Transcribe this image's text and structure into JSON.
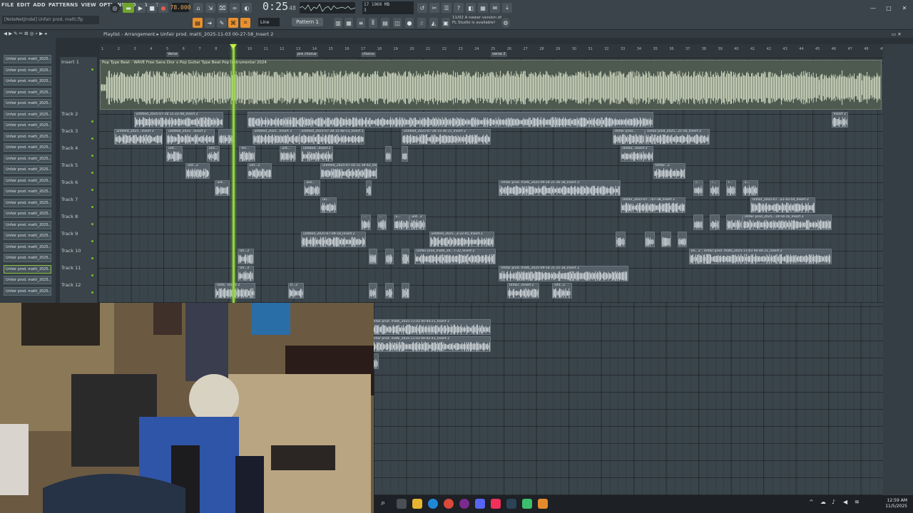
{
  "menu": [
    "FILE",
    "EDIT",
    "ADD",
    "PATTERNS",
    "VIEW",
    "OPTIONS",
    "TOOLS",
    "HELP"
  ],
  "transport": {
    "tempo": "78.000",
    "time": "0:25",
    "time_sub": "48",
    "play_icon": "play-icon",
    "stop_icon": "stop-icon",
    "record_icon": "record-icon"
  },
  "cpu": {
    "line1": "17    1960 MB",
    "line2": "3"
  },
  "hint_bar": "[NoteNetJindal] Unfair prod. matti.flp",
  "snap_mode": "Line",
  "pattern": "Pattern 1",
  "news": {
    "line1": "11/02  A newer version of",
    "line2": "FL Studio is available!"
  },
  "playlist": {
    "title": "Playlist - Arrangement",
    "breadcrumb": "Unfair prod. matti_2025-11-03 00-27-58_Insert 2"
  },
  "picker_items": [
    "Unfair prod. matti_2025...",
    "Unfair prod. matti_2025...",
    "Unfair prod. matti_2025...",
    "Unfair prod. matti_2025...",
    "Unfair prod. matti_2025...",
    "Unfair prod. matti_2025...",
    "Unfair prod. matti_2025...",
    "Unfair prod. matti_2025...",
    "Unfair prod. matti_2025...",
    "Unfair prod. matti_2025...",
    "Unfair prod. matti_2025...",
    "Unfair prod. matti_2025...",
    "Unfair prod. matti_2025...",
    "Unfair prod. matti_2025...",
    "Unfair prod. matti_2025...",
    "Unfair prod. matti_2025...",
    "Unfair prod. matti_2025...",
    "Unfair prod. matti_2025...",
    "Unfair prod. matti_2025...",
    "Unfair prod. matti_2025...",
    "Unfair prod. matti_2025...",
    "Unfair prod. matti_2025..."
  ],
  "tracks": [
    "Insert 1",
    "Track 2",
    "Track 3",
    "Track 4",
    "Track 5",
    "Track 6",
    "Track 7",
    "Track 8",
    "Track 9",
    "Track 10",
    "Track 11",
    "Track 12"
  ],
  "markers": [
    {
      "label": "Verse",
      "bar": 5
    },
    {
      "label": "pre chorus",
      "bar": 13
    },
    {
      "label": "chorus",
      "bar": 17
    },
    {
      "label": "verse 2",
      "bar": 25
    }
  ],
  "bars": [
    "1",
    "2",
    "3",
    "4",
    "5",
    "6",
    "7",
    "8",
    "9",
    "10",
    "11",
    "12",
    "13",
    "14",
    "15",
    "16",
    "17",
    "18",
    "19",
    "20",
    "21",
    "22",
    "23",
    "24",
    "25",
    "26",
    "27",
    "28",
    "29",
    "30",
    "31",
    "32",
    "33",
    "34",
    "35",
    "36",
    "37",
    "38",
    "39",
    "40",
    "41",
    "42",
    "43",
    "44",
    "45",
    "46",
    "47",
    "48",
    "49"
  ],
  "master_clip": "Pop Type Beat - WAVE  Free Sana Dior x Pop Guitar Type Beat  Pop Instrumental 2024",
  "clips": [
    {
      "t": 1,
      "b": 2.0,
      "len": 5.5,
      "l": "untitled_2025-07-18 11-22-48_Insert 2"
    },
    {
      "t": 1,
      "b": 9.0,
      "len": 25,
      "l": ""
    },
    {
      "t": 1,
      "b": 45.0,
      "len": 1,
      "l": "Insert 2"
    },
    {
      "t": 2,
      "b": 0.8,
      "len": 3,
      "l": "untitled_2025...Insert 2"
    },
    {
      "t": 2,
      "b": 4.0,
      "len": 3,
      "l": "untitled_2025...Insert 2"
    },
    {
      "t": 2,
      "b": 7.2,
      "len": 1,
      "l": ""
    },
    {
      "t": 2,
      "b": 9.3,
      "len": 3,
      "l": "untitled_2025...Insert 2"
    },
    {
      "t": 2,
      "b": 12.2,
      "len": 4,
      "l": "untitled_2025-07-28 15-48-53_Insert 2"
    },
    {
      "t": 2,
      "b": 18.5,
      "len": 5.5,
      "l": "untitled_2025-07-28 15-36-11_Insert 2"
    },
    {
      "t": 2,
      "b": 31.5,
      "len": 2,
      "l": "Unfair prod..."
    },
    {
      "t": 2,
      "b": 33.5,
      "len": 4,
      "l": "Unfair prod_2025...21-56_Insert 2"
    },
    {
      "t": 3,
      "b": 4.0,
      "len": 1,
      "l": "unt..."
    },
    {
      "t": 3,
      "b": 6.5,
      "len": 0.8,
      "l": "uns..."
    },
    {
      "t": 3,
      "b": 8.5,
      "len": 1,
      "l": "Ins..."
    },
    {
      "t": 3,
      "b": 11.0,
      "len": 1,
      "l": "unt..."
    },
    {
      "t": 3,
      "b": 12.3,
      "len": 2,
      "l": "untitled...Insert 2"
    },
    {
      "t": 3,
      "b": 17.5,
      "len": 0.4,
      "l": ""
    },
    {
      "t": 3,
      "b": 18.5,
      "len": 0.4,
      "l": ""
    },
    {
      "t": 3,
      "b": 32.0,
      "len": 2,
      "l": "Unfair...Insert 2"
    },
    {
      "t": 4,
      "b": 5.2,
      "len": 1.5,
      "l": "unt...2"
    },
    {
      "t": 4,
      "b": 9.0,
      "len": 1.5,
      "l": "unt...2"
    },
    {
      "t": 4,
      "b": 13.5,
      "len": 3.5,
      "l": "untitled_2025-07-18 11-39-42_Insert 2"
    },
    {
      "t": 4,
      "b": 34.0,
      "len": 2,
      "l": "Unfair...2"
    },
    {
      "t": 5,
      "b": 7.0,
      "len": 0.9,
      "l": "unt..."
    },
    {
      "t": 5,
      "b": 12.5,
      "len": 1,
      "l": "uns..."
    },
    {
      "t": 5,
      "b": 16.3,
      "len": 0.3,
      "l": ""
    },
    {
      "t": 5,
      "b": 24.5,
      "len": 7.5,
      "l": "Unfair prod. matti_2025-09-18 21-26-38_Insert 2"
    },
    {
      "t": 5,
      "b": 36.5,
      "len": 0.6,
      "l": "l..."
    },
    {
      "t": 5,
      "b": 37.5,
      "len": 0.6,
      "l": "l..."
    },
    {
      "t": 5,
      "b": 38.5,
      "len": 0.6,
      "l": "l..."
    },
    {
      "t": 5,
      "b": 39.5,
      "len": 1,
      "l": "u..."
    },
    {
      "t": 6,
      "b": 13.5,
      "len": 1,
      "l": "un..."
    },
    {
      "t": 6,
      "b": 32.0,
      "len": 4,
      "l": "Unfair_2025-07...-07-38_Insert 2"
    },
    {
      "t": 6,
      "b": 40.0,
      "len": 4,
      "l": "Unfair_2025-07...21-42-54_Insert 2"
    },
    {
      "t": 7,
      "b": 16.0,
      "len": 0.6,
      "l": "..."
    },
    {
      "t": 7,
      "b": 17.0,
      "len": 0.6,
      "l": "..."
    },
    {
      "t": 7,
      "b": 18.0,
      "len": 1,
      "l": "u..."
    },
    {
      "t": 7,
      "b": 19.0,
      "len": 1,
      "l": "unt...2"
    },
    {
      "t": 7,
      "b": 36.5,
      "len": 0.6,
      "l": ""
    },
    {
      "t": 7,
      "b": 37.5,
      "len": 0.6,
      "l": ""
    },
    {
      "t": 7,
      "b": 38.5,
      "len": 1,
      "l": ""
    },
    {
      "t": 7,
      "b": 39.5,
      "len": 5.5,
      "l": "Unfair prod_2025...19-54-16_Insert 2"
    },
    {
      "t": 8,
      "b": 12.3,
      "len": 4,
      "l": "untitled_2025-07-09-18_Insert 2"
    },
    {
      "t": 8,
      "b": 20.2,
      "len": 4,
      "l": "untitled_2025...3-22-45_Insert 2"
    },
    {
      "t": 8,
      "b": 31.7,
      "len": 0.6,
      "l": ""
    },
    {
      "t": 8,
      "b": 33.5,
      "len": 0.6,
      "l": ""
    },
    {
      "t": 8,
      "b": 34.5,
      "len": 0.6,
      "l": ""
    },
    {
      "t": 8,
      "b": 35.5,
      "len": 0.6,
      "l": ""
    },
    {
      "t": 9,
      "b": 8.4,
      "len": 1,
      "l": "Un...2"
    },
    {
      "t": 9,
      "b": 16.5,
      "len": 0.5,
      "l": ""
    },
    {
      "t": 9,
      "b": 17.5,
      "len": 0.5,
      "l": ""
    },
    {
      "t": 9,
      "b": 18.5,
      "len": 0.5,
      "l": ""
    },
    {
      "t": 9,
      "b": 19.3,
      "len": 5,
      "l": "Unfair prod_matti_20...7-32_Insert 2"
    },
    {
      "t": 9,
      "b": 36.2,
      "len": 1,
      "l": "Un...2"
    },
    {
      "t": 9,
      "b": 37.0,
      "len": 8,
      "l": "Unfair prod. matti_2025-11-03 00-44-21_Insert 2"
    },
    {
      "t": 10,
      "b": 8.4,
      "len": 1,
      "l": "Un...2"
    },
    {
      "t": 10,
      "b": 24.5,
      "len": 8,
      "l": "Unfair prod. matti_2025-09-18 21-25-18_Insert 2"
    },
    {
      "t": 11,
      "b": 7.0,
      "len": 2.5,
      "l": "Unfa...Insert 2"
    },
    {
      "t": 11,
      "b": 11.5,
      "len": 1,
      "l": "U...2"
    },
    {
      "t": 11,
      "b": 16.5,
      "len": 0.5,
      "l": ""
    },
    {
      "t": 11,
      "b": 17.5,
      "len": 0.5,
      "l": ""
    },
    {
      "t": 11,
      "b": 18.5,
      "len": 0.5,
      "l": ""
    },
    {
      "t": 11,
      "b": 25.0,
      "len": 2,
      "l": "Unfair...Insert 2"
    },
    {
      "t": 11,
      "b": 27.8,
      "len": 1.2,
      "l": "Unf...2"
    }
  ],
  "lower_clips": [
    {
      "row": 0,
      "b": 16.5,
      "len": 7.5,
      "l": "Unfair prod. matti_2025-11-03 00-44-21_Insert 2"
    },
    {
      "row": 1,
      "b": 16.5,
      "len": 7.5,
      "l": "Unfair prod. matti_2025-11-03 00-42-43_Insert 2"
    },
    {
      "row": 2,
      "b": 16.5,
      "len": 0.6,
      "l": ""
    }
  ],
  "taskbar": {
    "time": "12:59 AM",
    "date": "11/5/2025"
  }
}
